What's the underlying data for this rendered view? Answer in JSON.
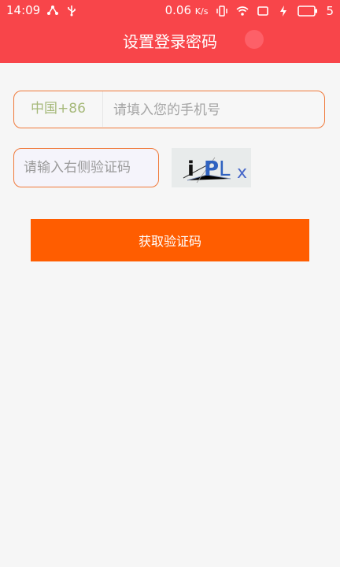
{
  "status_bar": {
    "time": "14:09",
    "speed": "0.06",
    "speed_unit": "K/s",
    "battery": "5"
  },
  "header": {
    "title": "设置登录密码"
  },
  "phone": {
    "country_code": "中国+86",
    "placeholder": "请填入您的手机号"
  },
  "captcha": {
    "placeholder": "请输入右侧验证码",
    "image_text": "iPLx"
  },
  "action": {
    "get_code_label": "获取验证码"
  },
  "colors": {
    "header": "#f8454a",
    "accent_border": "#f07a3b",
    "button": "#ff5d00",
    "country_text": "#a6b97a"
  }
}
